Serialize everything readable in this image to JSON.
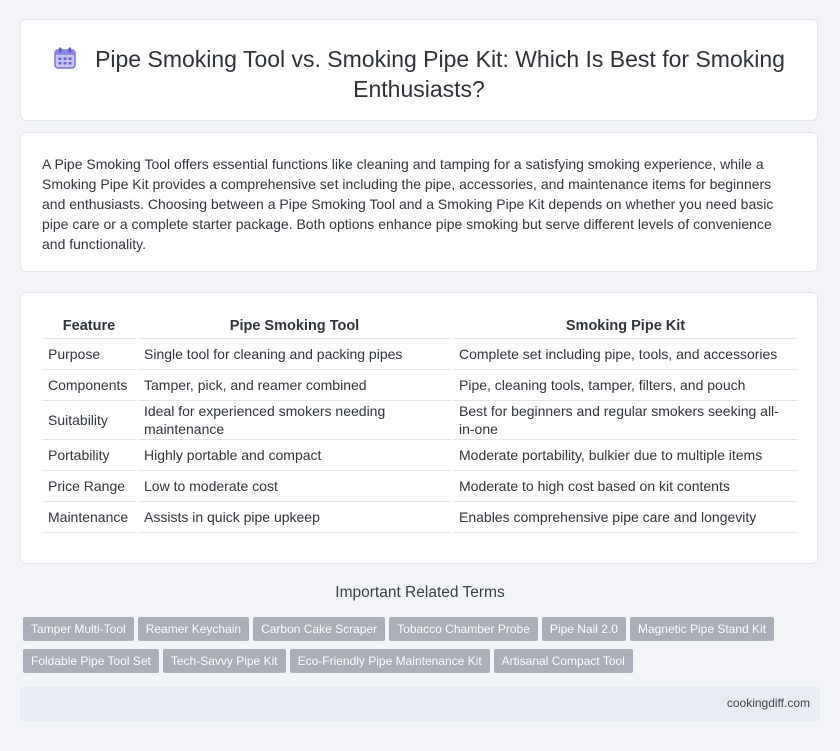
{
  "header": {
    "title": "Pipe Smoking Tool vs. Smoking Pipe Kit: Which Is Best for Smoking Enthusiasts?",
    "icon": "calendar-icon"
  },
  "intro": {
    "text": "A Pipe Smoking Tool offers essential functions like cleaning and tamping for a satisfying smoking experience, while a Smoking Pipe Kit provides a comprehensive set including the pipe, accessories, and maintenance items for beginners and enthusiasts. Choosing between a Pipe Smoking Tool and a Smoking Pipe Kit depends on whether you need basic pipe care or a complete starter package. Both options enhance pipe smoking but serve different levels of convenience and functionality."
  },
  "table": {
    "headers": [
      "Feature",
      "Pipe Smoking Tool",
      "Smoking Pipe Kit"
    ],
    "rows": [
      [
        "Purpose",
        "Single tool for cleaning and packing pipes",
        "Complete set including pipe, tools, and accessories"
      ],
      [
        "Components",
        "Tamper, pick, and reamer combined",
        "Pipe, cleaning tools, tamper, filters, and pouch"
      ],
      [
        "Suitability",
        "Ideal for experienced smokers needing maintenance",
        "Best for beginners and regular smokers seeking all-in-one"
      ],
      [
        "Portability",
        "Highly portable and compact",
        "Moderate portability, bulkier due to multiple items"
      ],
      [
        "Price Range",
        "Low to moderate cost",
        "Moderate to high cost based on kit contents"
      ],
      [
        "Maintenance",
        "Assists in quick pipe upkeep",
        "Enables comprehensive pipe care and longevity"
      ]
    ]
  },
  "related": {
    "title": "Important Related Terms",
    "tags_row1": [
      "Tamper Multi-Tool",
      "Reamer Keychain",
      "Carbon Cake Scraper",
      "Tobacco Chamber Probe",
      "Pipe Nail 2.0",
      "Magnetic Pipe Stand Kit"
    ],
    "tags_row2": [
      "Foldable Pipe Tool Set",
      "Tech-Savvy Pipe Kit",
      "Eco-Friendly Pipe Maintenance Kit",
      "Artisanal Compact Tool"
    ]
  },
  "footer": {
    "site": "cookingdiff.com"
  },
  "colors": {
    "tag_bg": "#a9aeb7",
    "footer_bg": "#e8ecf5",
    "page_bg": "#f3f4f7"
  }
}
